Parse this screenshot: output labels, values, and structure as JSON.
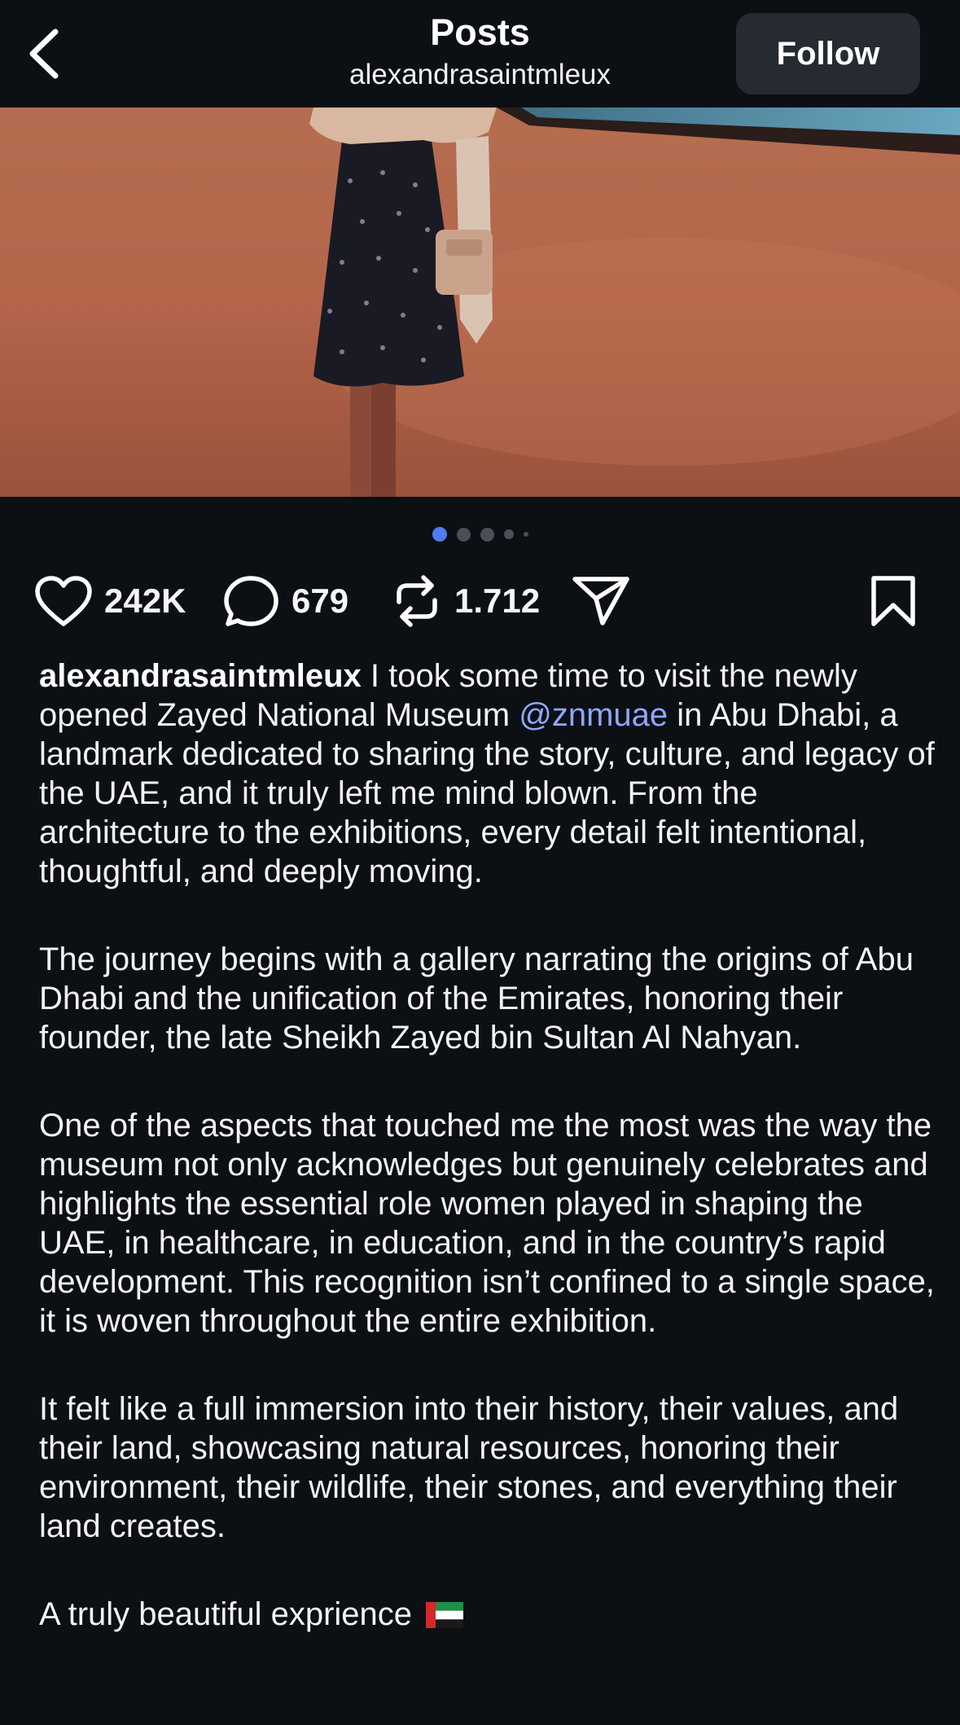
{
  "header": {
    "back_icon": "chevron-left-icon",
    "title": "Posts",
    "subtitle": "alexandrasaintmleux",
    "follow_label": "Follow"
  },
  "photo": {
    "description_icon": "post-photo"
  },
  "carousel": {
    "total_dots": 5,
    "active_index": 0
  },
  "actions": {
    "likes": "242K",
    "comments": "679",
    "reposts": "1.712",
    "like_icon": "heart-icon",
    "comment_icon": "comment-bubble-icon",
    "repost_icon": "repost-icon",
    "share_icon": "send-icon",
    "save_icon": "bookmark-icon"
  },
  "caption": {
    "username": "alexandrasaintmleux",
    "p1_before_mention": " I took some time to visit the newly opened Zayed National Museum ",
    "mention": "@znmuae",
    "p1_after_mention": " in Abu Dhabi, a landmark dedicated to sharing the story, culture, and legacy of the UAE, and it truly left me mind blown. From the architecture to the exhibitions, every detail felt intentional, thoughtful, and deeply moving.",
    "p2": "The journey begins with a gallery narrating the origins of Abu Dhabi and the unification of the Emirates, honoring their founder, the late Sheikh Zayed bin Sultan Al Nahyan.",
    "p3": "One of the aspects that touched me the most was the way the museum not only acknowledges but genuinely celebrates and highlights the essential role women played in shaping the UAE, in healthcare, in education, and in the country’s rapid development. This recognition isn’t confined to a single space, it is woven throughout the entire exhibition.",
    "p4": "It felt like a full immersion into their history, their values, and their land, showcasing natural resources, honoring their environment, their wildlife, their stones, and everything their land creates.",
    "p5": "A truly beautiful exprience",
    "flag_icon": "uae-flag-icon"
  },
  "colors": {
    "background": "#0c0f14",
    "accent": "#4d7cf5",
    "mention": "#8ea7ff",
    "follow_bg": "#262a31"
  }
}
